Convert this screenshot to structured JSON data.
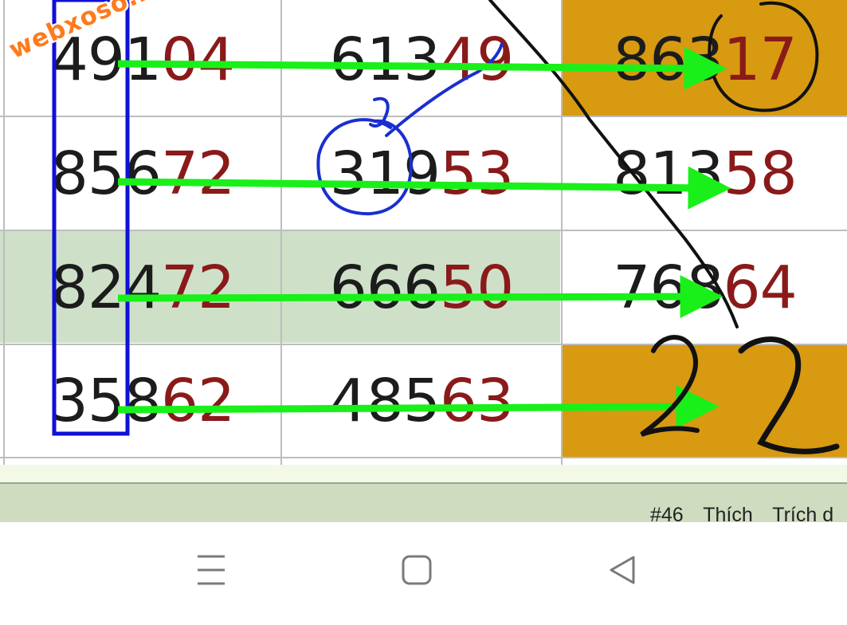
{
  "watermark": "webxoso.net",
  "rows": [
    {
      "col1": {
        "lead": "491",
        "tail": "04"
      },
      "col2": {
        "lead": "613",
        "tail": "49"
      },
      "col3": {
        "lead": "863",
        "tail": "17"
      }
    },
    {
      "col1": {
        "lead": "856",
        "tail": "72"
      },
      "col2": {
        "lead": "319",
        "tail": "53"
      },
      "col3": {
        "lead": "813",
        "tail": "58"
      }
    },
    {
      "col1": {
        "lead": "824",
        "tail": "72"
      },
      "col2": {
        "lead": "666",
        "tail": "50"
      },
      "col3": {
        "lead": "768",
        "tail": "64"
      }
    },
    {
      "col1": {
        "lead": "358",
        "tail": "62"
      },
      "col2": {
        "lead": "485",
        "tail": "63"
      },
      "col3": {
        "lead": "",
        "tail": ""
      }
    }
  ],
  "annotations": {
    "handwritten_result": "22"
  },
  "post": {
    "number": "#46",
    "like": "Thích",
    "quote": "Trích d"
  },
  "navbar": {
    "menu_icon": "menu-icon",
    "home_icon": "home-icon",
    "back_icon": "back-icon"
  },
  "colors": {
    "green_row": "#cfe0c9",
    "gold_cell": "#d79a10",
    "arrow": "#19f019",
    "box": "#1010d8",
    "tail_digits": "#8a1a1a"
  }
}
